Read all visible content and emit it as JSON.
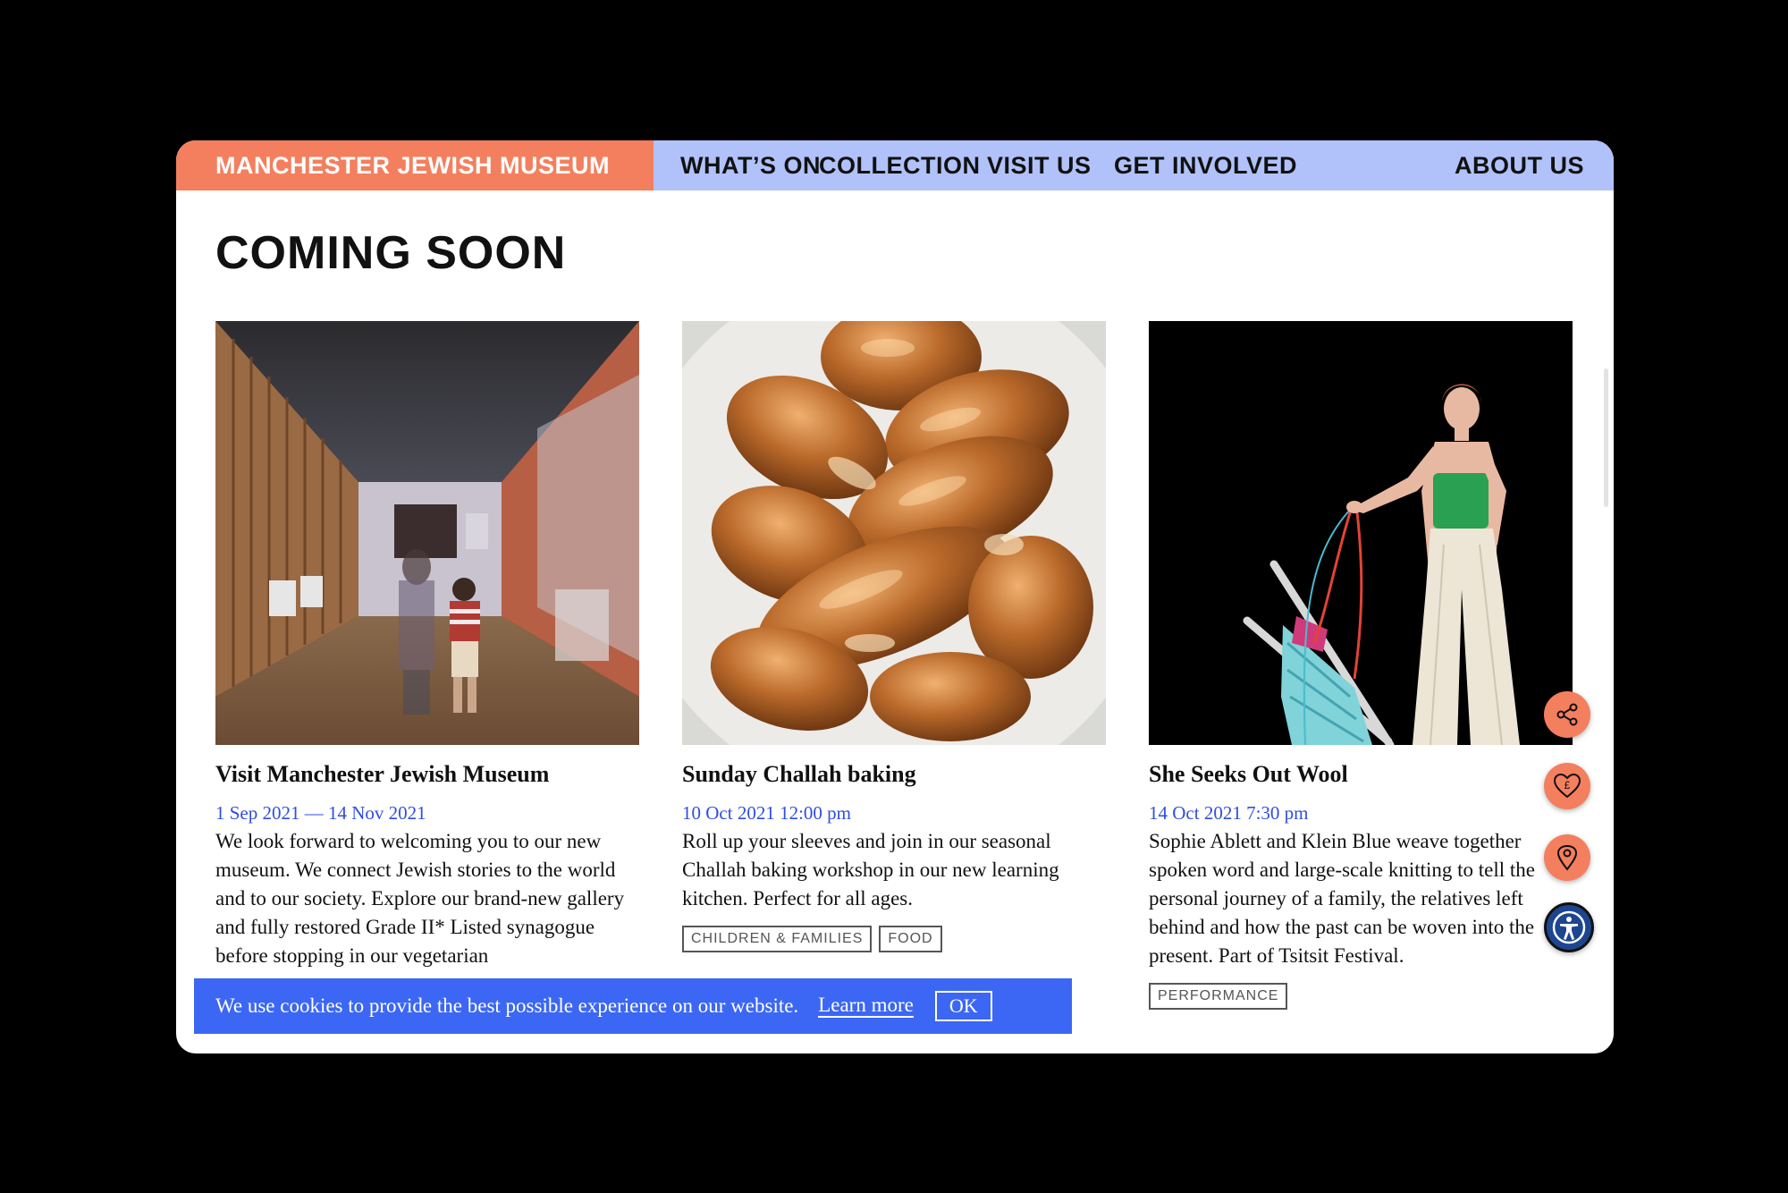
{
  "brand": "MANCHESTER JEWISH MUSEUM",
  "nav": [
    "WHAT’S ON",
    "COLLECTION",
    "VISIT US",
    "GET INVOLVED",
    "ABOUT US"
  ],
  "page_title": "COMING SOON",
  "cards": [
    {
      "title": "Visit Manchester Jewish Museum",
      "date": "1 Sep 2021 — 14 Nov 2021",
      "description": "We look forward to welcoming you to our new museum. We connect Jewish stories to the world and to our society. Explore our brand-new gallery and fully restored Grade II* Listed synagogue before stopping in our vegetarian",
      "tags": []
    },
    {
      "title": "Sunday Challah baking",
      "date": "10 Oct 2021 12:00 pm",
      "description": "Roll up your sleeves and join in our seasonal Challah baking workshop in our new learning kitchen. Perfect for all ages.",
      "tags": [
        "CHILDREN & FAMILIES",
        "FOOD"
      ]
    },
    {
      "title": "She Seeks Out Wool",
      "date": "14 Oct 2021 7:30 pm",
      "description": "Sophie Ablett and Klein Blue weave together spoken word and large-scale knitting to tell the personal journey of a family, the relatives left behind and how the past can be woven into the present. Part of Tsitsit Festival.",
      "tags": [
        "PERFORMANCE"
      ]
    }
  ],
  "cookie": {
    "text": "We use cookies to provide the best possible experience on our website.",
    "link": "Learn more",
    "ok": "OK"
  },
  "icons": [
    "share-icon",
    "donate-heart-icon",
    "location-pin-icon",
    "accessibility-icon"
  ],
  "colors": {
    "brand": "#f47f5e",
    "nav": "#b1c2fa",
    "date": "#2f4ee0",
    "cookie": "#3c67f4",
    "accessibility": "#1d4590"
  }
}
